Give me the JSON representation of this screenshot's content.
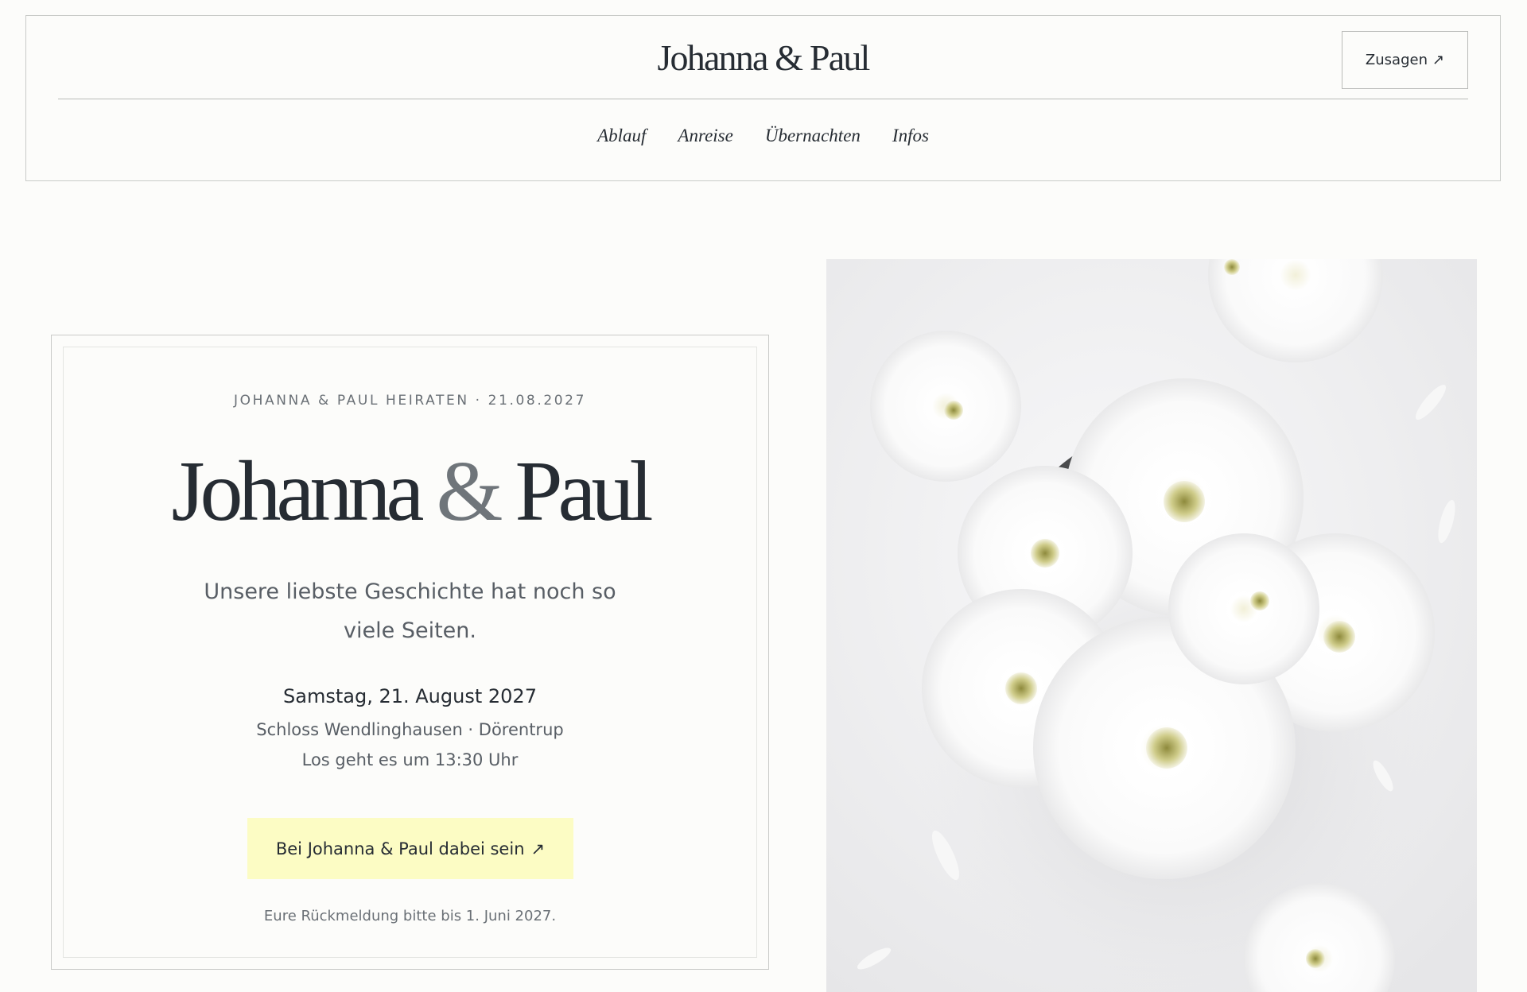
{
  "header": {
    "site_title": "Johanna & Paul",
    "rsvp_label": "Zusagen",
    "rsvp_arrow": "↗",
    "nav": [
      {
        "label": "Ablauf"
      },
      {
        "label": "Anreise"
      },
      {
        "label": "Übernachten"
      },
      {
        "label": "Infos"
      }
    ]
  },
  "hero": {
    "eyebrow": "JOHANNA & PAUL HEIRATEN · 21.08.2027",
    "title_name_1": "Johanna",
    "title_amp": "&",
    "title_name_2": "Paul",
    "tagline": "Unsere liebste Geschichte hat noch so viele Seiten.",
    "date": "Samstag, 21. August 2027",
    "location": "Schloss Wendlinghausen · Dörentrup",
    "time": "Los geht es um 13:30 Uhr",
    "cta_label": "Bei Johanna & Paul dabei sein",
    "cta_arrow": "↗",
    "rsvp_note": "Eure Rückmeldung bitte bis 1. Juni 2027."
  },
  "colors": {
    "background": "#fcfcfa",
    "text": "#262c33",
    "muted": "#585e65",
    "cta_background": "#fcfcc4",
    "border": "#c9cbc8"
  }
}
